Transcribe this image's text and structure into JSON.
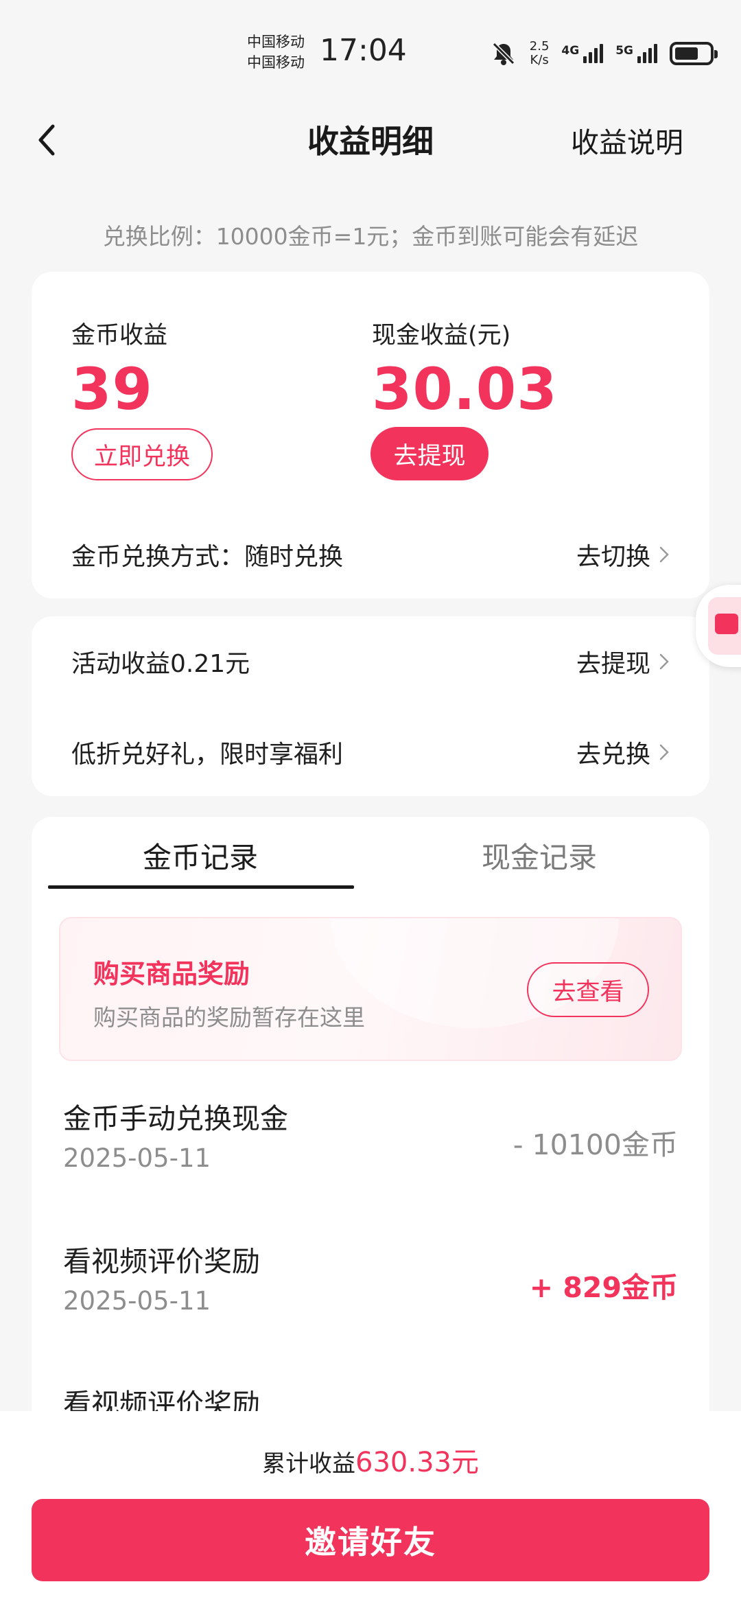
{
  "status_bar": {
    "carrier1": "中国移动",
    "carrier2": "中国移动",
    "time": "17:04",
    "speed_value": "2.5",
    "speed_unit": "K/s",
    "net1": "4G",
    "net2": "5G"
  },
  "nav": {
    "title": "收益明细",
    "right_link": "收益说明"
  },
  "ratio_note": "兑换比例：10000金币=1元；金币到账可能会有延迟",
  "earnings": {
    "coin_label": "金币收益",
    "coin_value": "39",
    "coin_button": "立即兑换",
    "cash_label": "现金收益(元)",
    "cash_value": "30.03",
    "cash_button": "去提现",
    "exchange_mode_label": "金币兑换方式：随时兑换",
    "exchange_mode_action": "去切换"
  },
  "activity": {
    "row1_label": "活动收益0.21元",
    "row1_action": "去提现",
    "row2_label": "低折兑好礼，限时享福利",
    "row2_action": "去兑换"
  },
  "records": {
    "tab_coin": "金币记录",
    "tab_cash": "现金记录",
    "promo_title": "购买商品奖励",
    "promo_sub": "购买商品的奖励暂存在这里",
    "promo_button": "去查看",
    "items": [
      {
        "name": "金币手动兑换现金",
        "date": "2025-05-11",
        "amount": "- 10100金币"
      },
      {
        "name": "看视频评价奖励",
        "date": "2025-05-11",
        "amount": "+ 829金币"
      },
      {
        "name": "看视频评价奖励",
        "date": "",
        "amount": ""
      }
    ]
  },
  "footer": {
    "total_label": "累计收益",
    "total_value": "630.33元",
    "invite_button": "邀请好友"
  },
  "colors": {
    "accent": "#f2335c",
    "muted": "#8d8d8d",
    "background": "#f6f6f6"
  }
}
